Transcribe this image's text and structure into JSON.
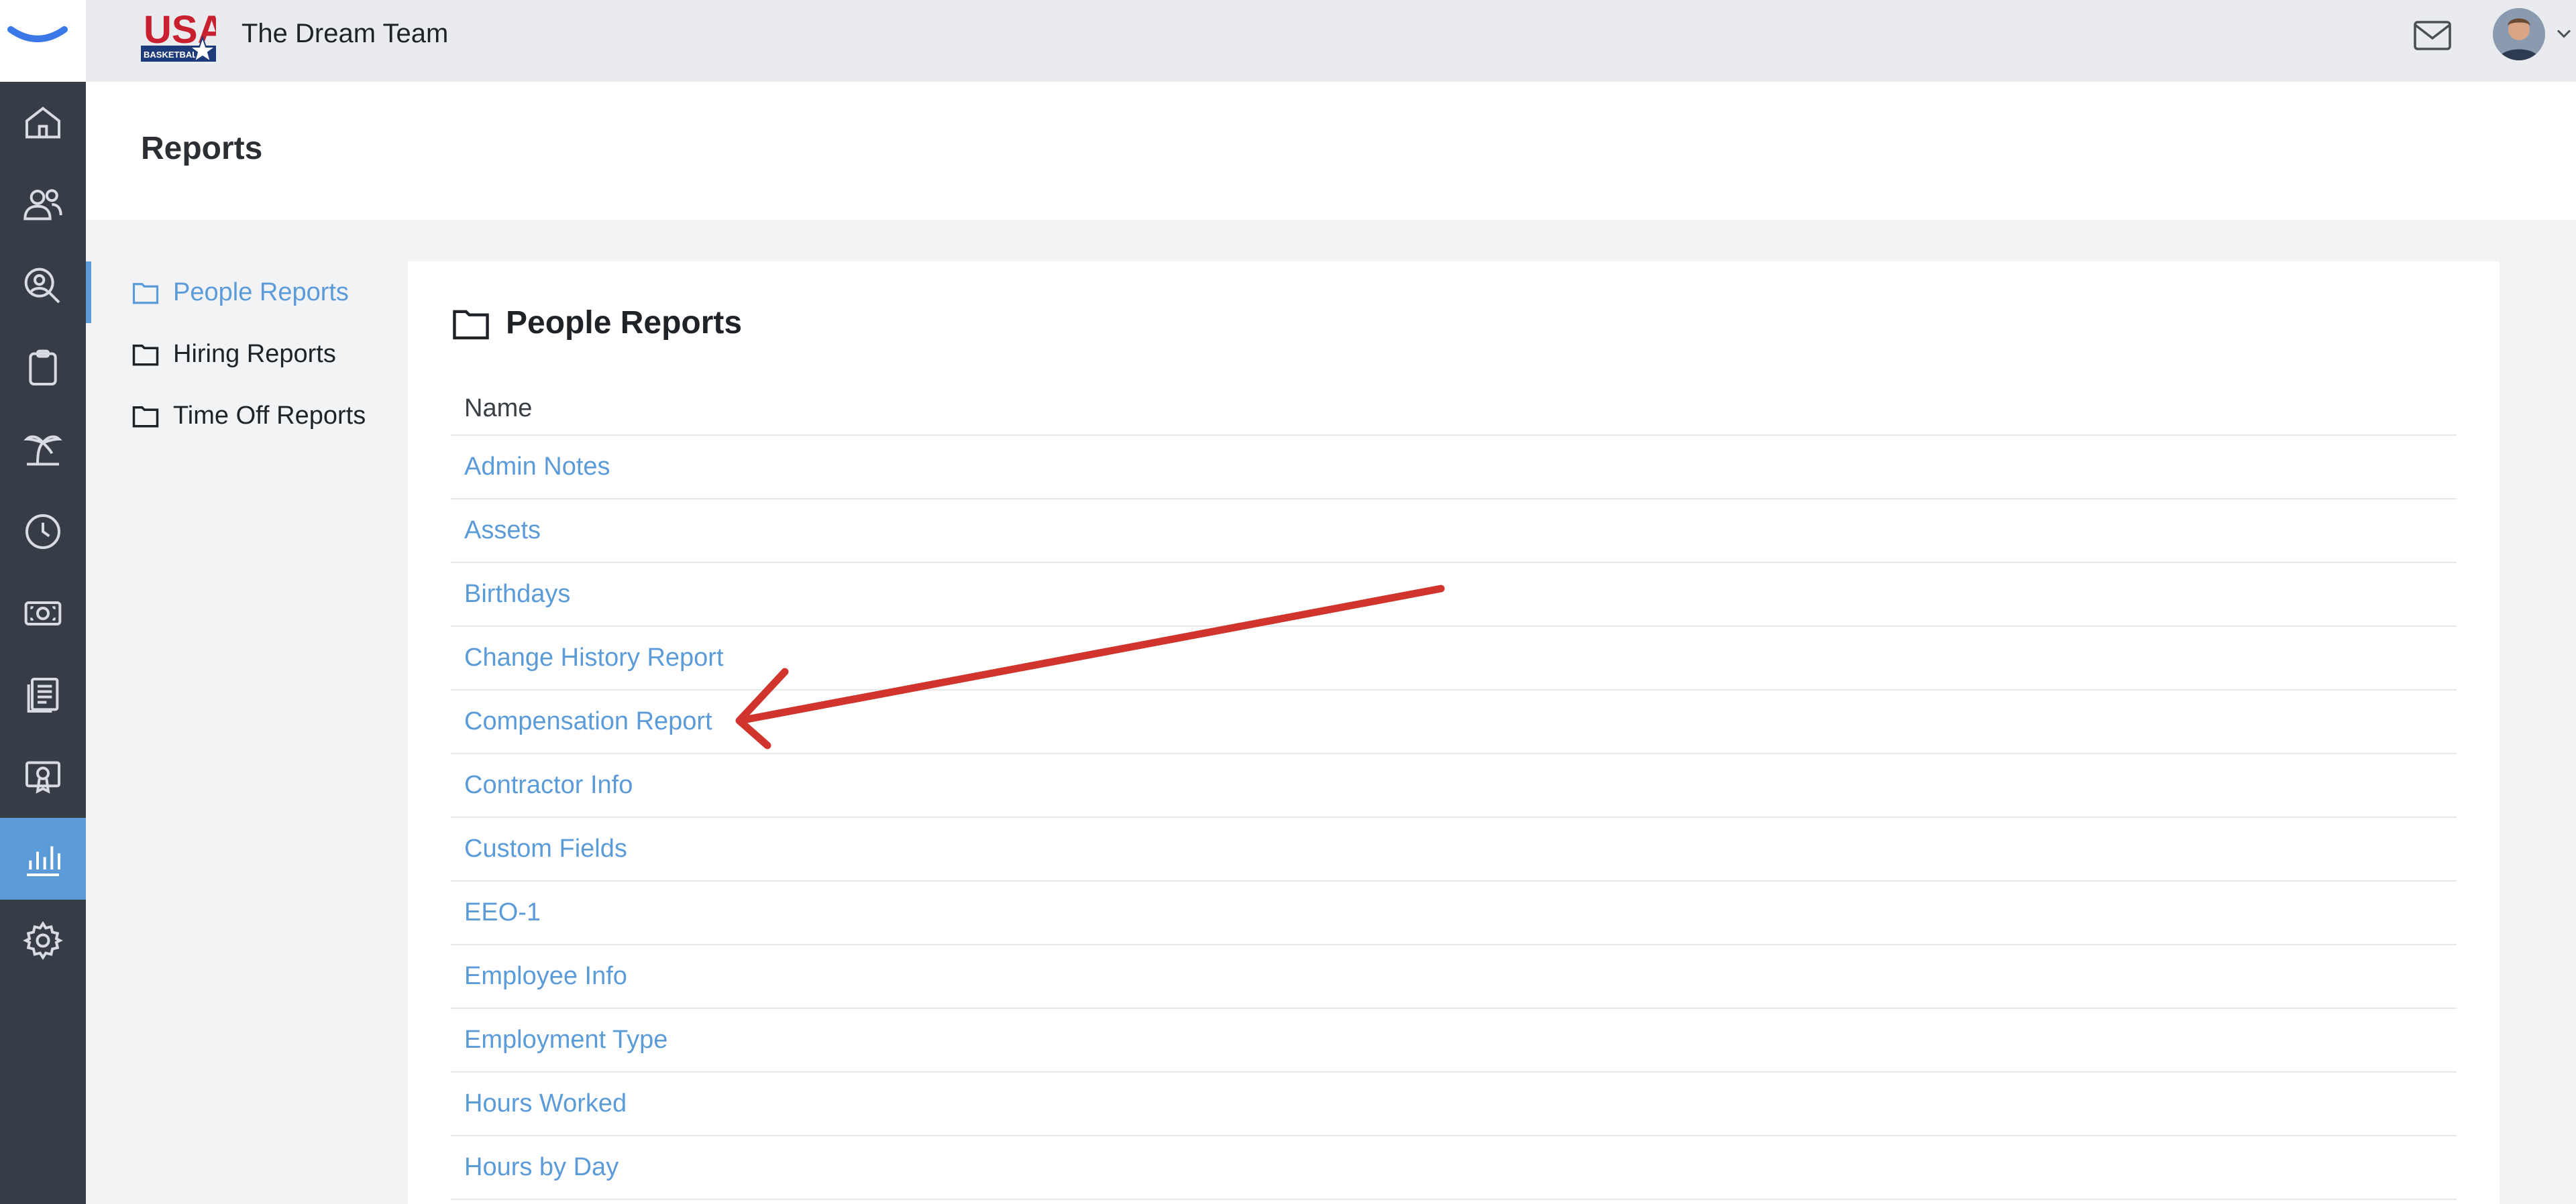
{
  "app": {
    "team_name": "The Dream Team",
    "logo_text": "USA",
    "logo_subtext": "BASKETBALL"
  },
  "rail": {
    "items": [
      {
        "icon": "home-icon"
      },
      {
        "icon": "people-icon"
      },
      {
        "icon": "search-person-icon"
      },
      {
        "icon": "clipboard-icon"
      },
      {
        "icon": "palm-tree-icon"
      },
      {
        "icon": "clock-icon"
      },
      {
        "icon": "money-icon"
      },
      {
        "icon": "documents-icon"
      },
      {
        "icon": "certificate-icon"
      },
      {
        "icon": "reports-chart-icon",
        "active": true
      },
      {
        "icon": "gear-icon"
      }
    ],
    "active_color": "#5b9bd8"
  },
  "page": {
    "title": "Reports"
  },
  "categories": [
    {
      "label": "People Reports",
      "active": true
    },
    {
      "label": "Hiring Reports",
      "active": false
    },
    {
      "label": "Time Off Reports",
      "active": false
    }
  ],
  "panel": {
    "title": "People Reports",
    "column_header": "Name",
    "rows": [
      "Admin Notes",
      "Assets",
      "Birthdays",
      "Change History Report",
      "Compensation Report",
      "Contractor Info",
      "Custom Fields",
      "EEO-1",
      "Employee Info",
      "Employment Type",
      "Hours Worked",
      "Hours by Day"
    ]
  },
  "colors": {
    "link": "#5b9bd8",
    "rail": "#373d47",
    "annotation_arrow": "#d0342c"
  }
}
